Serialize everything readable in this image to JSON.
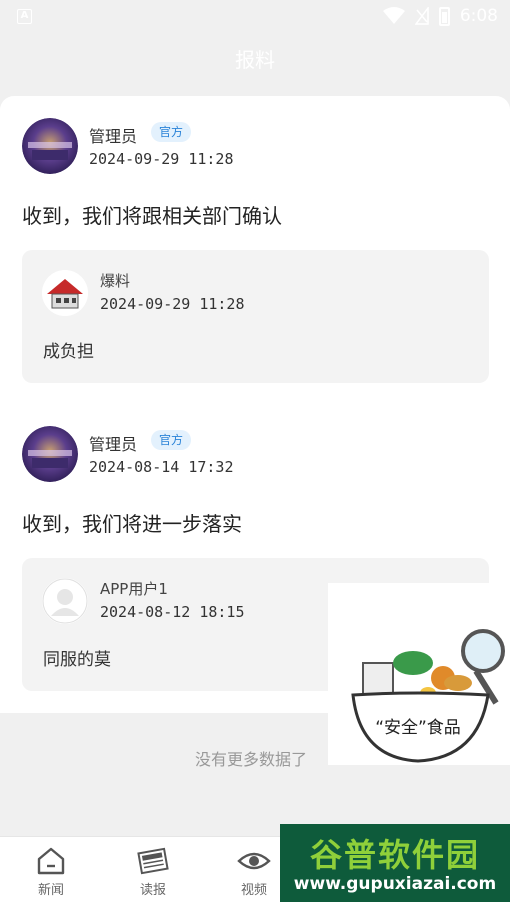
{
  "status_bar": {
    "time": "6:08"
  },
  "header": {
    "title": "报料"
  },
  "posts": [
    {
      "author": "管理员",
      "badge": "官方",
      "date": "2024-09-29  11:28",
      "text": "收到，我们将跟相关部门确认",
      "quote": {
        "author": "爆料",
        "date": "2024-09-29  11:28",
        "text": "成负担"
      }
    },
    {
      "author": "管理员",
      "badge": "官方",
      "date": "2024-08-14  17:32",
      "text": "收到，我们将进一步落实",
      "quote": {
        "author": "APP用户1",
        "date": "2024-08-12  18:15",
        "text": "同服的莫"
      }
    }
  ],
  "list_footer": "没有更多数据了",
  "tabs": [
    {
      "label": "新闻",
      "icon": "home-icon"
    },
    {
      "label": "读报",
      "icon": "newspaper-icon"
    },
    {
      "label": "视频",
      "icon": "eye-icon"
    }
  ],
  "ad": {
    "label": "“安全”食品"
  },
  "watermark": {
    "title": "谷普软件园",
    "url": "www.gupuxiazai.com"
  },
  "colors": {
    "badge_text": "#2a83d8",
    "badge_bg": "#e3f1fd",
    "page_bg": "#f0f0f0",
    "watermark_bg": "#0e5b3b"
  }
}
